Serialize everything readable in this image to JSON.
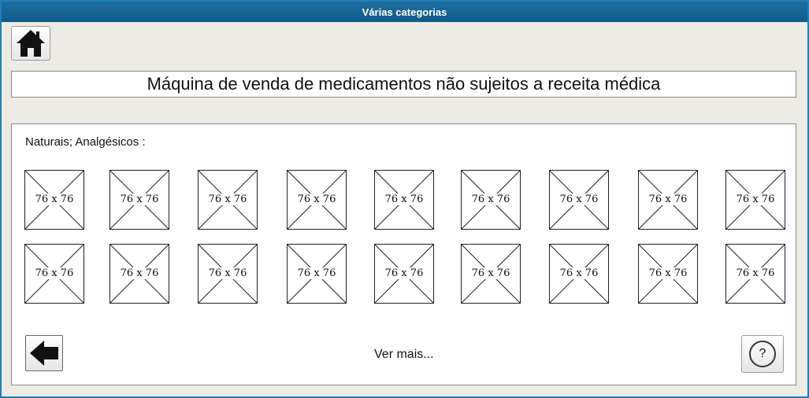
{
  "window": {
    "title": "Várias categorias"
  },
  "toolbar": {
    "home_icon": "home-icon"
  },
  "header": {
    "title": "Máquina de venda de medicamentos não sujeitos a receita médica"
  },
  "panel": {
    "category_label": "Naturais; Analgésicos :",
    "placeholder_text": "76 x 76",
    "rows": 2,
    "columns": 9
  },
  "footer": {
    "back_icon": "arrow-left-icon",
    "more_label": "Ver mais...",
    "help_label": "?"
  }
}
